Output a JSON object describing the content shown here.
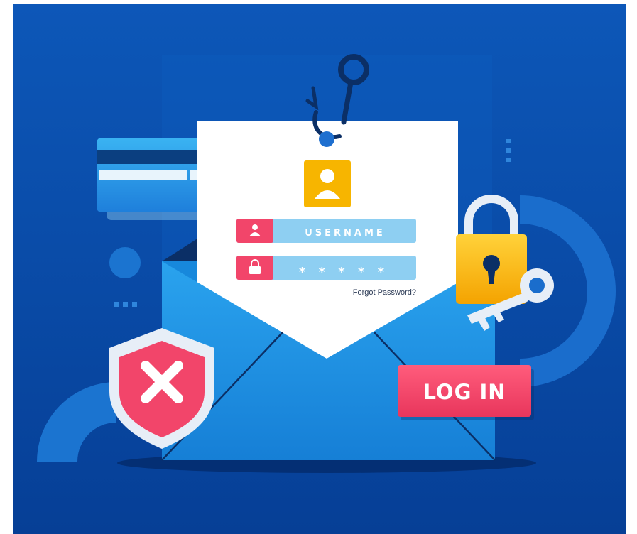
{
  "login_form": {
    "username_label": "USERNAME",
    "password_mask": "* * * * *",
    "forgot_link": "Forgot Password?"
  },
  "login_button": {
    "label": "LOG IN"
  },
  "icons": {
    "hook": "fish-hook-icon",
    "avatar": "user-avatar-icon",
    "user_field": "user-icon",
    "password_field": "lock-small-icon",
    "padlock": "padlock-icon",
    "key": "key-icon",
    "shield": "shield-x-icon",
    "card": "credit-card-icon",
    "envelope": "envelope-icon"
  },
  "colors": {
    "background": "#0a4aa6",
    "accent_red": "#f2456a",
    "field_blue": "#8ecff2",
    "avatar_yellow": "#f7b500",
    "envelope_blue": "#1f92e6",
    "paper": "#ffffff"
  }
}
